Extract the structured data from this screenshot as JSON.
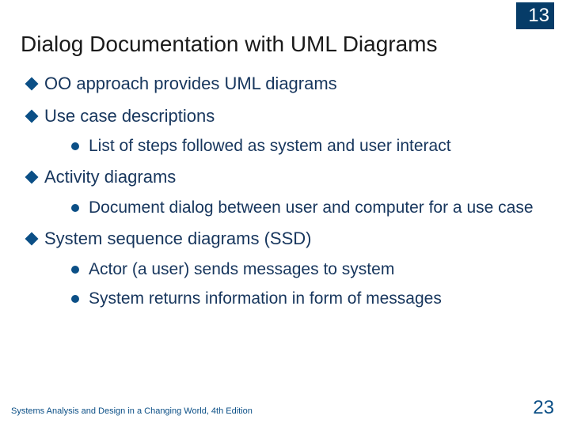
{
  "chapter_number": "13",
  "title": "Dialog Documentation with UML Diagrams",
  "bullets": [
    {
      "text": "OO  approach provides UML diagrams",
      "subs": []
    },
    {
      "text": "Use case descriptions",
      "subs": [
        "List of steps followed as system and user interact"
      ]
    },
    {
      "text": "Activity diagrams",
      "subs": [
        "Document dialog between user and computer for a use case"
      ]
    },
    {
      "text": "System sequence diagrams (SSD)",
      "subs": [
        "Actor (a user) sends messages to system",
        "System returns information in form of messages"
      ]
    }
  ],
  "footer_left": "Systems Analysis and Design in a Changing World, 4th Edition",
  "page_number": "23"
}
